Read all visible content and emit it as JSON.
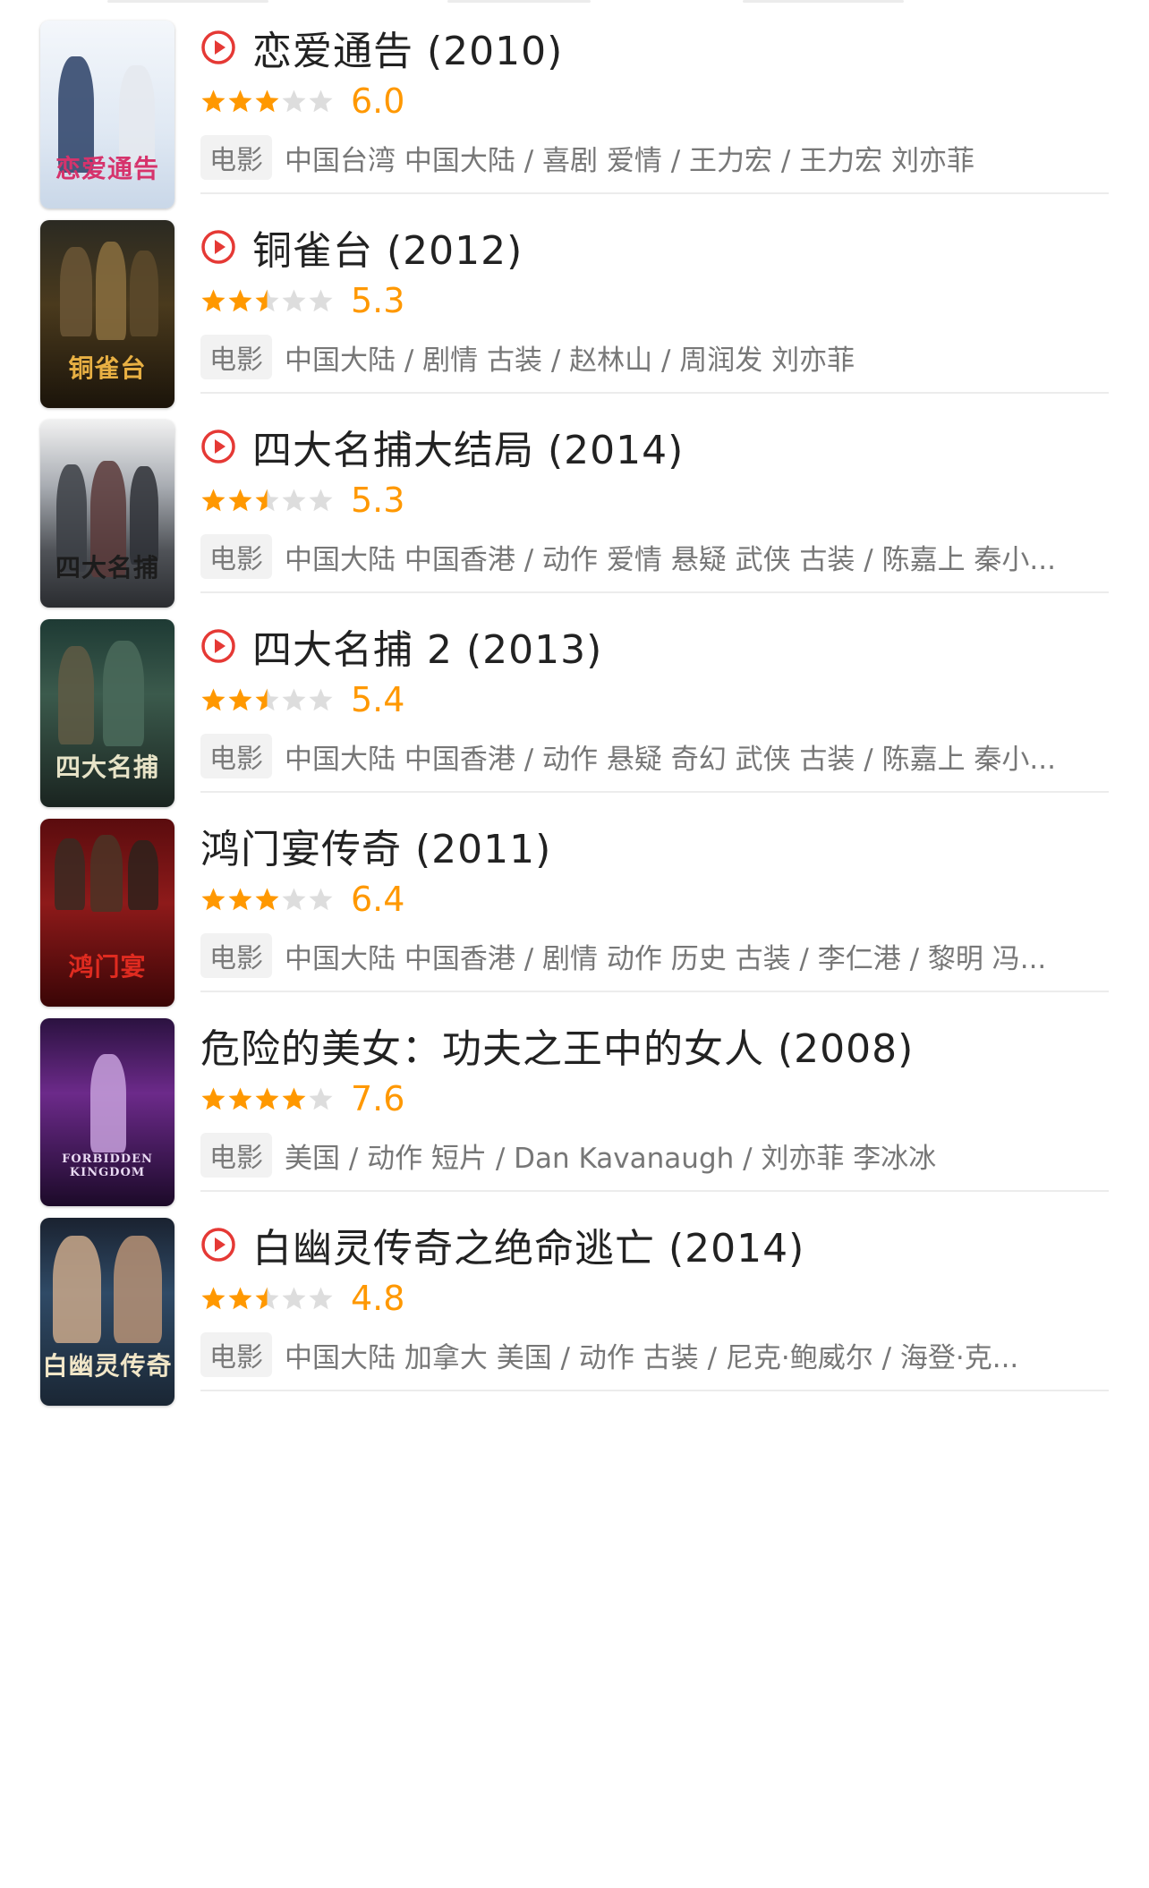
{
  "colors": {
    "accent_red": "#e53935",
    "star_orange": "#ff9800",
    "star_grey": "#dddddd"
  },
  "items": [
    {
      "title": "恋爱通告 (2010)",
      "has_play": true,
      "rating": "6.0",
      "stars_value": 3.0,
      "tag": "电影",
      "meta": "中国台湾 中国大陆 / 喜剧 爱情 / 王力宏 / 王力宏 刘亦菲",
      "poster_text": "恋爱通告"
    },
    {
      "title": "铜雀台 (2012)",
      "has_play": true,
      "rating": "5.3",
      "stars_value": 2.5,
      "tag": "电影",
      "meta": "中国大陆 / 剧情 古装 / 赵林山 / 周润发 刘亦菲",
      "poster_text": "铜雀台"
    },
    {
      "title": "四大名捕大结局 (2014)",
      "has_play": true,
      "rating": "5.3",
      "stars_value": 2.5,
      "tag": "电影",
      "meta": "中国大陆 中国香港 / 动作 爱情 悬疑 武侠 古装 / 陈嘉上 秦小...",
      "poster_text": "四大名捕"
    },
    {
      "title": "四大名捕 2 (2013)",
      "has_play": true,
      "rating": "5.4",
      "stars_value": 2.5,
      "tag": "电影",
      "meta": "中国大陆 中国香港 / 动作 悬疑 奇幻 武侠 古装 / 陈嘉上 秦小...",
      "poster_text": "四大名捕"
    },
    {
      "title": "鸿门宴传奇 (2011)",
      "has_play": false,
      "rating": "6.4",
      "stars_value": 3.0,
      "tag": "电影",
      "meta": "中国大陆 中国香港 / 剧情 动作 历史 古装 / 李仁港 / 黎明 冯...",
      "poster_text": "鸿门宴"
    },
    {
      "title": "危险的美女：功夫之王中的女人 (2008)",
      "has_play": false,
      "rating": "7.6",
      "stars_value": 4.0,
      "tag": "电影",
      "meta": "美国 / 动作 短片 / Dan Kavanaugh / 刘亦菲 李冰冰",
      "poster_text": "FORBIDDEN KINGDOM"
    },
    {
      "title": "白幽灵传奇之绝命逃亡 (2014)",
      "has_play": true,
      "rating": "4.8",
      "stars_value": 2.5,
      "tag": "电影",
      "meta": "中国大陆 加拿大 美国 / 动作 古装 / 尼克·鲍威尔 / 海登·克...",
      "poster_text": "白幽灵传奇"
    }
  ]
}
